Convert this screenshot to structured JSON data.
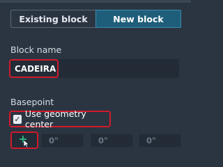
{
  "tabs": [
    {
      "label": "Existing block",
      "active": false
    },
    {
      "label": "New block",
      "active": true
    }
  ],
  "block_name": {
    "label": "Block name",
    "value": "CADEIRA"
  },
  "basepoint": {
    "label": "Basepoint",
    "use_geometry_center": {
      "label": "Use geometry center",
      "checked": true
    },
    "pick_icon": "crosshair-pick-icon",
    "coords": {
      "x": "0\"",
      "y": "0\"",
      "z": "0\""
    }
  },
  "colors": {
    "background": "#2b3542",
    "accent": "#1f5e7a",
    "highlight": "#d11a2a",
    "pick_icon": "#2fcf8f"
  }
}
